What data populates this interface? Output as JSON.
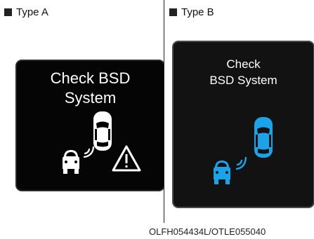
{
  "type_a": {
    "label": "Type A",
    "message": [
      "Check BSD",
      "System"
    ]
  },
  "type_b": {
    "label": "Type B",
    "message": [
      "Check",
      "BSD System"
    ]
  },
  "footer_code": "OLFH054434L/OTLE055040",
  "colors": {
    "type_b_icon": "#1aa3e8",
    "type_a_icon": "#ffffff"
  },
  "icons": [
    "bullet-square-icon",
    "car-top-view-icon",
    "car-front-view-icon",
    "radar-waves-icon",
    "warning-triangle-icon"
  ]
}
